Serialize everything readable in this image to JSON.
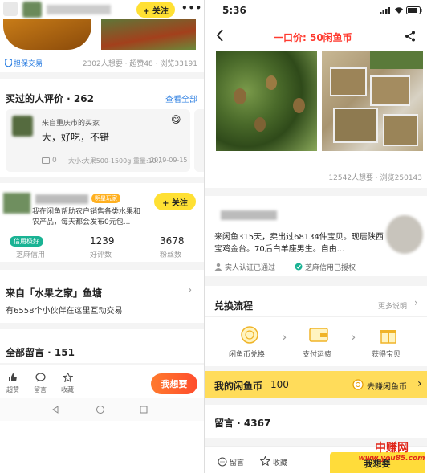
{
  "left": {
    "top": {
      "follow_label": "+ 关注",
      "more_label": "•••"
    },
    "guarantee": {
      "label": "担保交易",
      "stats": "2302人想要 · 超赞48 · 浏览33191"
    },
    "reviews": {
      "title": "买过的人评价 · 262",
      "view_all": "查看全部",
      "card": {
        "from": "来自重庆市的买家",
        "text": "大，好吃，不错",
        "comment_count": "0",
        "meta": "大小:大果500-1500g 重量:10...",
        "date": "2019-09-15"
      }
    },
    "seller": {
      "badge": "明星玩家",
      "follow_label": "+ 关注",
      "desc": "我在闲鱼帮助农户销售各类水果和农产品，每天都会发布0元包...",
      "credit_badge": "信用极好",
      "credit_label": "芝麻信用",
      "good_count": "1239",
      "good_label": "好评数",
      "fans_count": "3678",
      "fans_label": "粉丝数"
    },
    "pond": {
      "title": "来自「水果之家」鱼塘",
      "subtitle": "有6558个小伙伴在这里互动交易"
    },
    "comments": {
      "title": "全部留言 · 151"
    },
    "bottom_bar": {
      "like": "超赞",
      "comment": "留言",
      "favorite": "收藏",
      "want": "我想要"
    }
  },
  "right": {
    "status": {
      "time": "5:36"
    },
    "nav": {
      "title": "一口价: 50闲鱼币"
    },
    "stats": "12542人想要 · 浏览250143",
    "seller": {
      "desc": "来闲鱼315天，卖出过68134件宝贝。现居陕西宝鸡金台。70后白羊座男生。自由...",
      "verified": "实人认证已通过",
      "zhima": "芝麻信用已授权"
    },
    "exchange": {
      "title": "兑换流程",
      "more": "更多说明",
      "steps": [
        "闲鱼币兑换",
        "支付运费",
        "获得宝贝"
      ]
    },
    "coins": {
      "label": "我的闲鱼币",
      "value": "100",
      "earn": "去赚闲鱼币"
    },
    "comments": {
      "title": "留言 · 4367"
    },
    "bottom_bar": {
      "comment": "留言",
      "favorite": "收藏",
      "want": "我想要"
    },
    "watermark": {
      "line1": "中赚网",
      "line2": "www.you85.com"
    }
  },
  "colors": {
    "accent_yellow": "#ffe033",
    "want_red": "#ff4d2d",
    "link_blue": "#2a7de1",
    "credit_green": "#1ab394",
    "title_red": "#ff3b30",
    "watermark_red": "#e0261a"
  }
}
